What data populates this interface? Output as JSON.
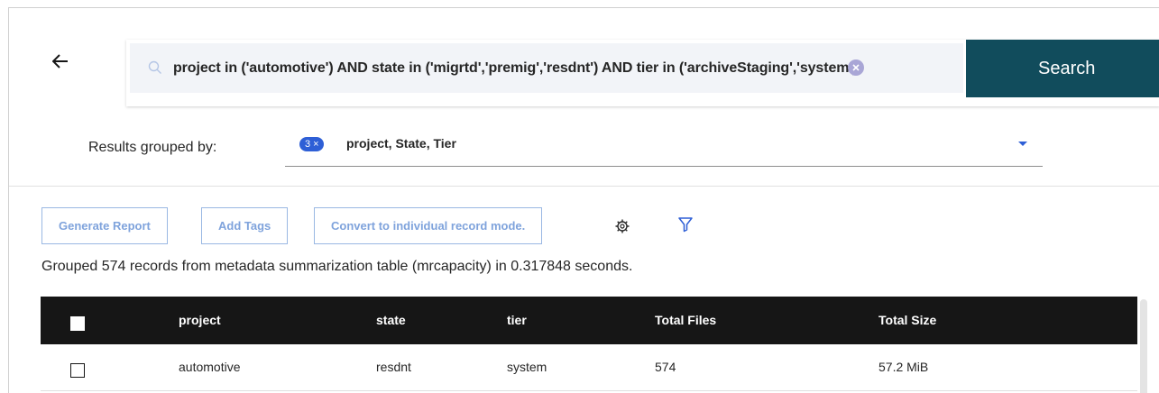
{
  "search": {
    "query": "project in ('automotive') AND state in ('migrtd','premig','resdnt') AND tier in ('archiveStaging','system')",
    "button_label": "Search"
  },
  "grouping": {
    "label": "Results grouped by:",
    "count": "3",
    "clear_symbol": "×",
    "values": "project, State, Tier"
  },
  "toolbar": {
    "generate_report": "Generate Report",
    "add_tags": "Add Tags",
    "convert_mode": "Convert to individual record mode."
  },
  "summary": "Grouped 574 records from metadata summarization table (mrcapacity) in 0.317848 seconds.",
  "table": {
    "columns": [
      "project",
      "state",
      "tier",
      "Total Files",
      "Total Size"
    ],
    "rows": [
      [
        "automotive",
        "resdnt",
        "system",
        "574",
        "57.2 MiB"
      ]
    ]
  },
  "icons": {
    "back": "arrow-left-icon",
    "search": "search-icon",
    "clear": "clear-icon",
    "settings": "gear-icon",
    "filter": "filter-icon"
  },
  "colors": {
    "search_button": "#114c5c",
    "tag_blue": "#2e5fd6",
    "toolbar_border": "#9ab8e3",
    "table_header": "#161616"
  }
}
